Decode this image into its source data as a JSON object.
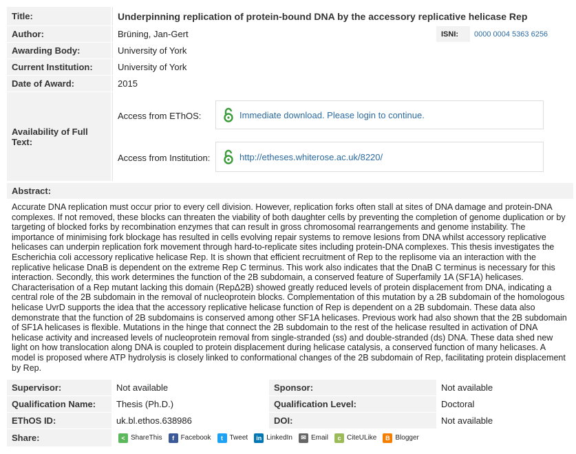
{
  "title": {
    "label": "Title:",
    "value": "Underpinning replication of protein-bound DNA by the accessory replicative helicase Rep"
  },
  "author": {
    "label": "Author:",
    "value": "Brüning, Jan-Gert",
    "isni_label": "ISNI:",
    "isni_value": "0000 0004 5363 6256"
  },
  "awarding_body": {
    "label": "Awarding Body:",
    "value": "University of York"
  },
  "current_institution": {
    "label": "Current Institution:",
    "value": "University of York"
  },
  "date_of_award": {
    "label": "Date of Award:",
    "value": "2015"
  },
  "availability": {
    "label": "Availability of Full Text:",
    "ethos_label": "Access from EThOS:",
    "ethos_link": "Immediate download. Please login to continue.",
    "institution_label": "Access from Institution:",
    "institution_link": "http://etheses.whiterose.ac.uk/8220/"
  },
  "abstract": {
    "label": "Abstract:",
    "text": "Accurate DNA replication must occur prior to every cell division. However, replication forks often stall at sites of DNA damage and protein-DNA complexes. If not removed, these blocks can threaten the viability of both daughter cells by preventing the completion of genome duplication or by targeting of blocked forks by recombination enzymes that can result in gross chromosomal rearrangements and genome instability. The importance of minimising fork blockage has resulted in cells evolving repair systems to remove lesions from DNA whilst accessory replicative helicases can underpin replication fork movement through hard-to-replicate sites including protein-DNA complexes. This thesis investigates the Escherichia coli accessory replicative helicase Rep. It is shown that efficient recruitment of Rep to the replisome via an interaction with the replicative helicase DnaB is dependent on the extreme Rep C terminus. This work also indicates that the DnaB C terminus is necessary for this interaction. Secondly, this work determines the function of the 2B subdomain, a conserved feature of Superfamily 1A (SF1A) helicases. Characterisation of a Rep mutant lacking this domain (RepΔ2B) showed greatly reduced levels of protein displacement from DNA, indicating a central role of the 2B subdomain in the removal of nucleoprotein blocks. Complementation of this mutation by a 2B subdomain of the homologous helicase UvrD supports the idea that the accessory replicative helicase function of Rep is dependent on a 2B subdomain. These data also demonstrate that the function of 2B subdomains is conserved among other SF1A helicases. Previous work had also shown that the 2B subdomain of SF1A helicases is flexible. Mutations in the hinge that connect the 2B subdomain to the rest of the helicase resulted in activation of DNA helicase activity and increased levels of nucleoprotein removal from single-stranded (ss) and double-stranded (ds) DNA. These data shed new light on how translocation along DNA is coupled to protein displacement during helicase catalysis, a conserved function of many helicases. A model is proposed where ATP hydrolysis is closely linked to conformational changes of the 2B subdomain of Rep, facilitating protein displacement by Rep."
  },
  "supervisor": {
    "label": "Supervisor:",
    "value": "Not available"
  },
  "sponsor": {
    "label": "Sponsor:",
    "value": "Not available"
  },
  "qualification_name": {
    "label": "Qualification Name:",
    "value": "Thesis (Ph.D.)"
  },
  "qualification_level": {
    "label": "Qualification Level:",
    "value": "Doctoral"
  },
  "ethos_id": {
    "label": "EThOS ID:",
    "value": "uk.bl.ethos.638986"
  },
  "doi": {
    "label": "DOI:",
    "value": "Not available"
  },
  "share": {
    "label": "Share:",
    "items": [
      {
        "label": "ShareThis",
        "icon": "sharethis-icon",
        "color": "#5cb85c"
      },
      {
        "label": "Facebook",
        "icon": "facebook-icon",
        "color": "#3b5998"
      },
      {
        "label": "Tweet",
        "icon": "twitter-icon",
        "color": "#1da1f2"
      },
      {
        "label": "LinkedIn",
        "icon": "linkedin-icon",
        "color": "#0077b5"
      },
      {
        "label": "Email",
        "icon": "email-icon",
        "color": "#666666"
      },
      {
        "label": "CiteULike",
        "icon": "citeulike-icon",
        "color": "#9bbb59"
      },
      {
        "label": "Blogger",
        "icon": "blogger-icon",
        "color": "#f57d00"
      }
    ]
  },
  "colors": {
    "link": "#2a6aa0",
    "open_access": "#3a9a3a"
  }
}
